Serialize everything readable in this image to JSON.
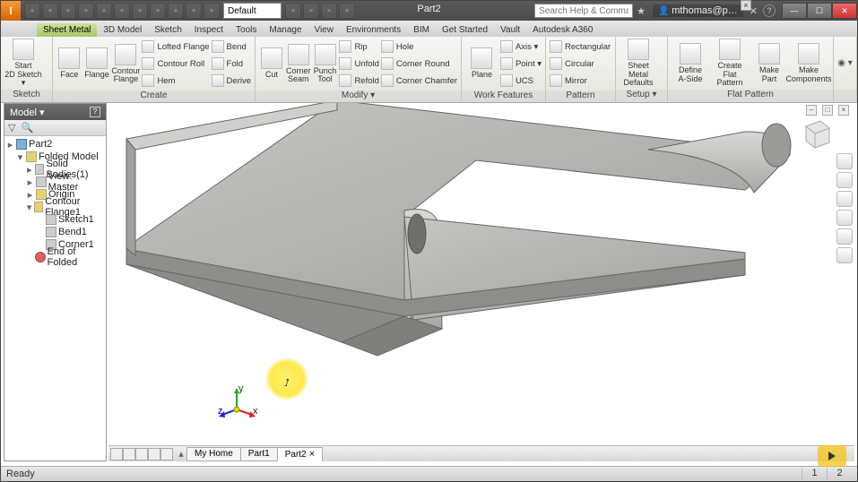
{
  "app": {
    "letter": "I",
    "title": "Part2",
    "style": "Default",
    "search_ph": "Search Help & Commands…",
    "user": "mthomas@p…"
  },
  "qat": [
    "new",
    "open",
    "save",
    "undo",
    "redo",
    "home",
    "sel",
    "appr",
    "mat",
    "color1",
    "color2"
  ],
  "qat2": [
    "a",
    "b",
    "fx",
    "d"
  ],
  "tabs": [
    "Sheet Metal",
    "3D Model",
    "Sketch",
    "Inspect",
    "Tools",
    "Manage",
    "View",
    "Environments",
    "BIM",
    "Get Started",
    "Vault",
    "Autodesk A360"
  ],
  "active_tab": 0,
  "ribbon": {
    "sketch": {
      "title": "Sketch",
      "btn": "Start\n2D Sketch ▾"
    },
    "create": {
      "title": "Create",
      "big": [
        "Face",
        "Flange",
        "Contour\nFlange"
      ],
      "rows": [
        "Lofted Flange",
        "Contour Roll",
        "Hem"
      ],
      "rows2": [
        "Bend",
        "Fold",
        "Derive"
      ]
    },
    "modify": {
      "title": "Modify ▾",
      "big": [
        "Cut",
        "Corner\nSeam",
        "Punch\nTool"
      ],
      "rows": [
        "Rip",
        "Unfold",
        "Refold"
      ],
      "rows2": [
        "Hole",
        "Corner Round",
        "Corner Chamfer"
      ]
    },
    "work": {
      "title": "Work Features",
      "big": "Plane",
      "rows": [
        "Axis ▾",
        "Point ▾",
        "UCS"
      ]
    },
    "pattern": {
      "title": "Pattern",
      "rows": [
        "Rectangular",
        "Circular",
        "Mirror"
      ]
    },
    "setup": {
      "title": "Setup ▾",
      "big": "Sheet Metal\nDefaults"
    },
    "flat": {
      "title": "Flat Pattern",
      "big": [
        "Define\nA-Side",
        "Create\nFlat Pattern",
        "Make\nPart",
        "Make\nComponents"
      ]
    }
  },
  "browser": {
    "header": "Model ▾",
    "nodes": [
      {
        "t": "Part2",
        "i": 0,
        "ic": "blue",
        "tw": "▸"
      },
      {
        "t": "Folded Model",
        "i": 1,
        "ic": "",
        "tw": "▾"
      },
      {
        "t": "Solid Bodies(1)",
        "i": 2,
        "ic": "gray",
        "tw": "▸"
      },
      {
        "t": "View: Master",
        "i": 2,
        "ic": "gray",
        "tw": "▸"
      },
      {
        "t": "Origin",
        "i": 2,
        "ic": "",
        "tw": "▸"
      },
      {
        "t": "Contour Flange1",
        "i": 2,
        "ic": "",
        "tw": "▾"
      },
      {
        "t": "Sketch1",
        "i": 3,
        "ic": "gray",
        "tw": ""
      },
      {
        "t": "Bend1",
        "i": 3,
        "ic": "gray",
        "tw": ""
      },
      {
        "t": "Corner1",
        "i": 3,
        "ic": "gray",
        "tw": ""
      },
      {
        "t": "End of Folded",
        "i": 2,
        "ic": "red",
        "tw": ""
      }
    ]
  },
  "doctabs": {
    "tools": 5,
    "tabs": [
      "My Home",
      "Part1",
      "Part2"
    ],
    "active": 2
  },
  "status": {
    "text": "Ready",
    "cells": [
      "1",
      "2"
    ]
  },
  "vp_small": [
    "–",
    "□",
    "×"
  ]
}
